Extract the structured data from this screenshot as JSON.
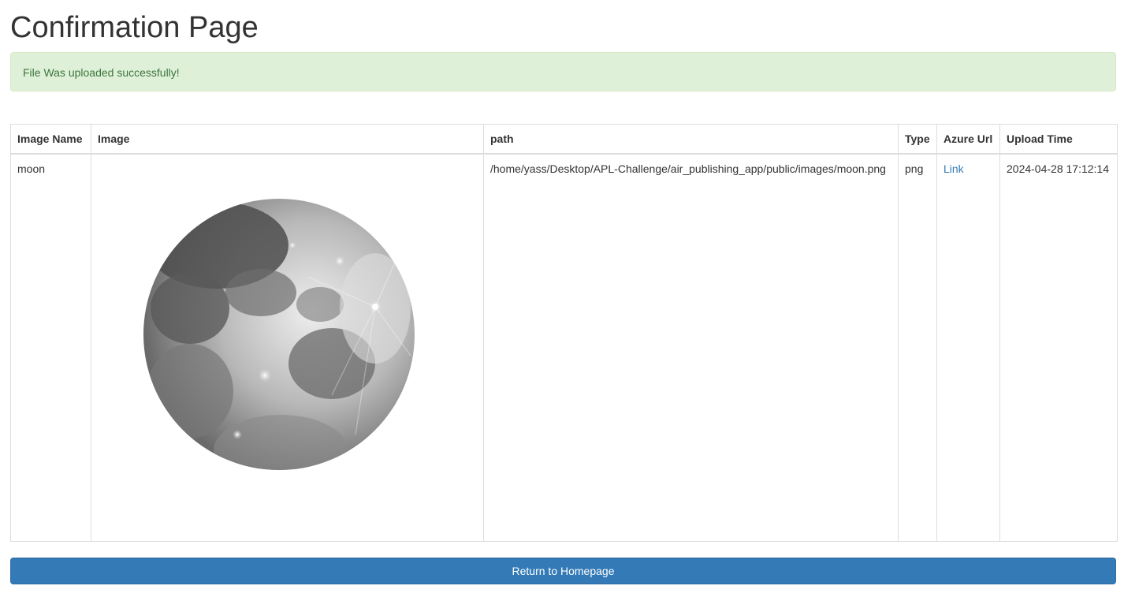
{
  "page": {
    "title": "Confirmation Page"
  },
  "alert": {
    "message": "File Was uploaded successfully!",
    "background_color": "#dff0d8",
    "text_color": "#3c763d"
  },
  "table": {
    "headers": {
      "image_name": "Image Name",
      "image": "Image",
      "path": "path",
      "type": "Type",
      "azure_url": "Azure Url",
      "upload_time": "Upload Time"
    },
    "rows": [
      {
        "image_name": "moon",
        "image_icon": "moon-image",
        "path": "/home/yass/Desktop/APL-Challenge/air_publishing_app/public/images/moon.png",
        "type": "png",
        "azure_url_label": "Link",
        "upload_time": "2024-04-28 17:12:14"
      }
    ]
  },
  "button": {
    "label": "Return to Homepage",
    "color": "#337ab7"
  },
  "link_color": "#337ab7"
}
